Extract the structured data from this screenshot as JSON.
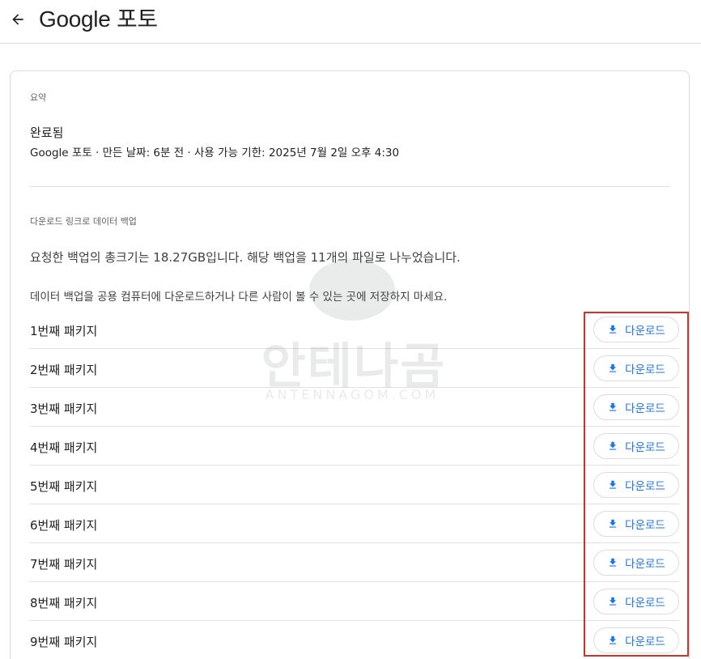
{
  "header": {
    "title": "Google 포토",
    "back_icon": "arrow-back-icon"
  },
  "summary": {
    "label": "요약",
    "status": "완료됨",
    "meta": "Google 포토 · 만든 날짜: 6분 전 · 사용 가능 기한: 2025년 7월 2일 오후 4:30"
  },
  "download_section": {
    "label": "다운로드 링크로 데이터 백업",
    "info": "요청한 백업의 총크기는 18.27GB입니다. 해당 백업을 11개의 파일로 나누었습니다.",
    "warning": "데이터 백업을 공용 컴퓨터에 다운로드하거나 다른 사람이 볼 수 있는 곳에 저장하지 마세요."
  },
  "packages": [
    {
      "name": "1번째 패키지",
      "button_label": "다운로드"
    },
    {
      "name": "2번째 패키지",
      "button_label": "다운로드"
    },
    {
      "name": "3번째 패키지",
      "button_label": "다운로드"
    },
    {
      "name": "4번째 패키지",
      "button_label": "다운로드"
    },
    {
      "name": "5번째 패키지",
      "button_label": "다운로드"
    },
    {
      "name": "6번째 패키지",
      "button_label": "다운로드"
    },
    {
      "name": "7번째 패키지",
      "button_label": "다운로드"
    },
    {
      "name": "8번째 패키지",
      "button_label": "다운로드"
    },
    {
      "name": "9번째 패키지",
      "button_label": "다운로드"
    }
  ],
  "watermark": {
    "text": "안테나곰",
    "sub": "ANTENNAGOM.COM"
  },
  "colors": {
    "accent": "#1a73e8",
    "highlight": "#d93025",
    "divider": "#dadce0"
  }
}
